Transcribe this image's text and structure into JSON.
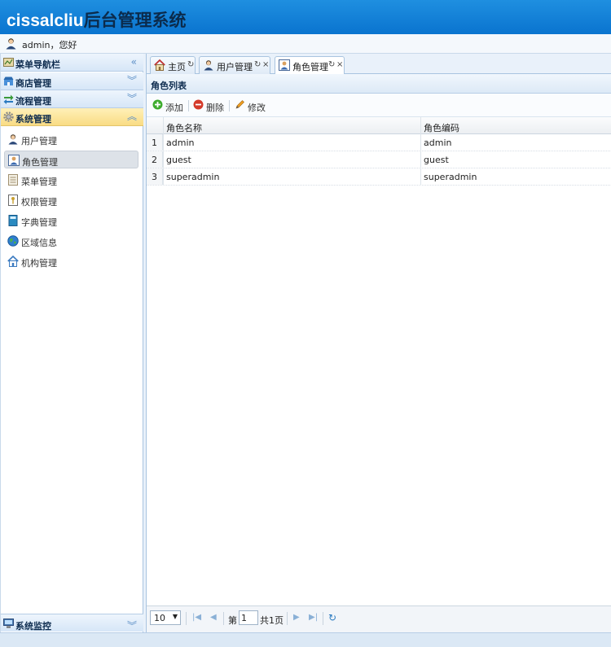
{
  "header": {
    "brand": "cissalcliu",
    "subtitle": "后台管理系统"
  },
  "userbar": {
    "text": "admin，您好"
  },
  "sidebar": {
    "nav_title": "菜单导航栏",
    "sections": [
      {
        "label": "商店管理"
      },
      {
        "label": "流程管理"
      },
      {
        "label": "系统管理"
      }
    ],
    "items": [
      {
        "label": "用户管理"
      },
      {
        "label": "角色管理"
      },
      {
        "label": "菜单管理"
      },
      {
        "label": "权限管理"
      },
      {
        "label": "字典管理"
      },
      {
        "label": "区域信息"
      },
      {
        "label": "机构管理"
      }
    ],
    "bottom_section": "系统监控"
  },
  "tabs": [
    {
      "label": "主页"
    },
    {
      "label": "用户管理"
    },
    {
      "label": "角色管理"
    }
  ],
  "panel": {
    "title": "角色列表"
  },
  "toolbar": {
    "add": "添加",
    "delete": "删除",
    "edit": "修改"
  },
  "grid": {
    "columns": [
      "角色名称",
      "角色编码"
    ],
    "rows": [
      {
        "n": "1",
        "name": "admin",
        "code": "admin"
      },
      {
        "n": "2",
        "name": "guest",
        "code": "guest"
      },
      {
        "n": "3",
        "name": "superadmin",
        "code": "superadmin"
      }
    ]
  },
  "pager": {
    "page_size": "10",
    "page_prefix": "第",
    "page_value": "1",
    "page_total": "共1页"
  },
  "colors": {
    "header": "#0a74cf",
    "active_section": "#f9dc84",
    "accent": "#5c8fc6"
  }
}
